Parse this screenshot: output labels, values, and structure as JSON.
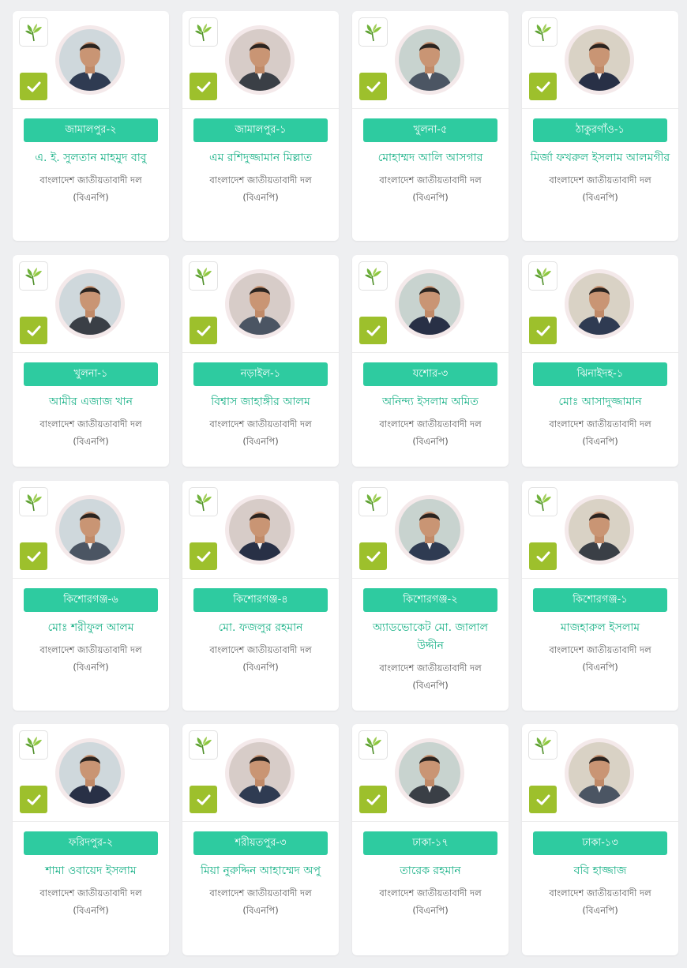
{
  "colors": {
    "accent": "#2ecba0",
    "name_text": "#19b187",
    "check_bg": "#9dc02c",
    "page_bg": "#eeeff1",
    "party_text": "#555555"
  },
  "icons": {
    "symbol": "paddy-sheaf-icon",
    "verified": "check-icon"
  },
  "candidates": [
    {
      "seat": "জামালপুর-২",
      "name": "এ. ই. সুলতান মাহমুদ বাবু",
      "party": "বাংলাদেশ জাতীয়তাবাদী দল (বিএনপি)"
    },
    {
      "seat": "জামালপুর-১",
      "name": "এম রশিদুজ্জামান মিল্লাত",
      "party": "বাংলাদেশ জাতীয়তাবাদী দল (বিএনপি)"
    },
    {
      "seat": "খুলনা-৫",
      "name": "মোহাম্মদ আলি আসগার",
      "party": "বাংলাদেশ জাতীয়তাবাদী দল (বিএনপি)"
    },
    {
      "seat": "ঠাকুরগাঁও-১",
      "name": "মির্জা ফখরুল ইসলাম আলমগীর",
      "party": "বাংলাদেশ জাতীয়তাবাদী দল (বিএনপি)"
    },
    {
      "seat": "খুলনা-১",
      "name": "আমীর এজাজ খান",
      "party": "বাংলাদেশ জাতীয়তাবাদী দল (বিএনপি)"
    },
    {
      "seat": "নড়াইল-১",
      "name": "বিশ্বাস জাহাঙ্গীর আলম",
      "party": "বাংলাদেশ জাতীয়তাবাদী দল (বিএনপি)"
    },
    {
      "seat": "যশোর-৩",
      "name": "অনিন্দ্য ইসলাম অমিত",
      "party": "বাংলাদেশ জাতীয়তাবাদী দল (বিএনপি)"
    },
    {
      "seat": "ঝিনাইদহ-১",
      "name": "মোঃ আসাদুজ্জামান",
      "party": "বাংলাদেশ জাতীয়তাবাদী দল (বিএনপি)"
    },
    {
      "seat": "কিশোরগঞ্জ-৬",
      "name": "মোঃ শরীফুল আলম",
      "party": "বাংলাদেশ জাতীয়তাবাদী দল (বিএনপি)"
    },
    {
      "seat": "কিশোরগঞ্জ-৪",
      "name": "মো. ফজলুর রহমান",
      "party": "বাংলাদেশ জাতীয়তাবাদী দল (বিএনপি)"
    },
    {
      "seat": "কিশোরগঞ্জ-২",
      "name": "অ্যাডভোকেট মো. জালাল উদ্দীন",
      "party": "বাংলাদেশ জাতীয়তাবাদী দল (বিএনপি)"
    },
    {
      "seat": "কিশোরগঞ্জ-১",
      "name": "মাজহারুল ইসলাম",
      "party": "বাংলাদেশ জাতীয়তাবাদী দল (বিএনপি)"
    },
    {
      "seat": "ফরিদপুর-২",
      "name": "শামা ওবায়েদ ইসলাম",
      "party": "বাংলাদেশ জাতীয়তাবাদী দল (বিএনপি)"
    },
    {
      "seat": "শরীয়তপুর-৩",
      "name": "মিয়া নুরুদ্দিন আহাম্মেদ অপু",
      "party": "বাংলাদেশ জাতীয়তাবাদী দল (বিএনপি)"
    },
    {
      "seat": "ঢাকা-১৭",
      "name": "তারেক রহমান",
      "party": "বাংলাদেশ জাতীয়তাবাদী দল (বিএনপি)"
    },
    {
      "seat": "ঢাকা-১৩",
      "name": "ববি হাজ্জাজ",
      "party": "বাংলাদেশ জাতীয়তাবাদী দল (বিএনপি)"
    }
  ]
}
